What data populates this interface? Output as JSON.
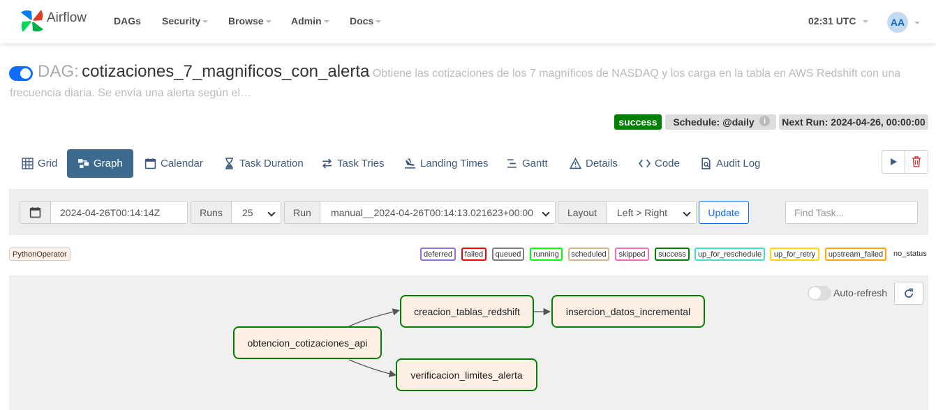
{
  "nav": {
    "brand": "Airflow",
    "items": [
      "DAGs",
      "Security",
      "Browse",
      "Admin",
      "Docs"
    ],
    "clock": "02:31 UTC",
    "avatar": "AA"
  },
  "dag": {
    "prefix": "DAG:",
    "id": "cotizaciones_7_magnificos_con_alerta",
    "description": "Obtiene las cotizaciones de los 7 magníficos de NASDAQ y los carga en la tabla en AWS Redshift con una frecuencia diaria. Se envía una alerta según el…",
    "paused": false
  },
  "badges": {
    "status": "success",
    "schedule": "Schedule: @daily",
    "info": "i",
    "next_run": "Next Run: 2024-04-26, 00:00:00"
  },
  "tabs": [
    {
      "label": "Grid",
      "icon": "grid-icon"
    },
    {
      "label": "Graph",
      "icon": "graph-icon",
      "active": true
    },
    {
      "label": "Calendar",
      "icon": "calendar-icon"
    },
    {
      "label": "Task Duration",
      "icon": "hourglass-icon"
    },
    {
      "label": "Task Tries",
      "icon": "retry-icon"
    },
    {
      "label": "Landing Times",
      "icon": "plane-landing-icon"
    },
    {
      "label": "Gantt",
      "icon": "gantt-icon"
    },
    {
      "label": "Details",
      "icon": "warning-triangle-icon"
    },
    {
      "label": "Code",
      "icon": "code-icon"
    },
    {
      "label": "Audit Log",
      "icon": "audit-log-icon"
    }
  ],
  "actions": {
    "trigger": "play-icon",
    "delete": "trash-icon"
  },
  "filters": {
    "base_date": "2024-04-26T00:14:14Z",
    "runs_label": "Runs",
    "runs_value": "25",
    "run_label": "Run",
    "run_value": "manual__2024-04-26T00:14:13.021623+00:00",
    "layout_label": "Layout",
    "layout_value": "Left > Right",
    "update_label": "Update",
    "find_placeholder": "Find Task..."
  },
  "legend": {
    "operator": "PythonOperator",
    "states": [
      "deferred",
      "failed",
      "queued",
      "running",
      "scheduled",
      "skipped",
      "success",
      "up_for_reschedule",
      "up_for_retry",
      "upstream_failed",
      "no_status"
    ]
  },
  "colors": {
    "deferred": "#9370db",
    "failed": "#ff0000",
    "queued": "#808080",
    "running": "#00ff00",
    "scheduled": "#d2b48c",
    "skipped": "#ff69b4",
    "success": "#008000",
    "up_for_reschedule": "#40e0d0",
    "up_for_retry": "#ffd700",
    "upstream_failed": "#ffa500",
    "accent": "#3d6a8f"
  },
  "graph": {
    "auto_refresh_label": "Auto-refresh",
    "auto_refresh_on": false,
    "tasks": [
      "obtencion_cotizaciones_api",
      "creacion_tablas_redshift",
      "insercion_datos_incremental",
      "verificacion_limites_alerta"
    ]
  }
}
